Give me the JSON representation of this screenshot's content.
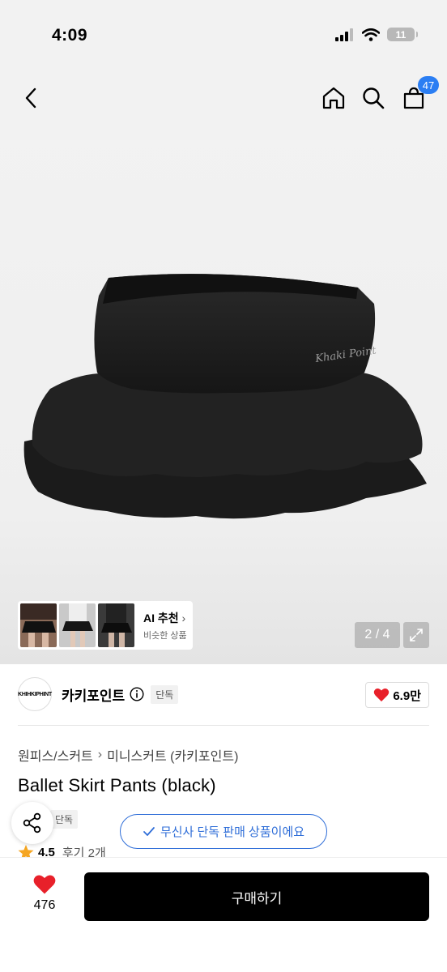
{
  "status_bar": {
    "time": "4:09",
    "battery": "11"
  },
  "nav": {
    "cart_count": "47"
  },
  "gallery": {
    "ai_title": "AI 추천",
    "ai_subtitle": "비슷한 상품",
    "page_indicator": "2 / 4"
  },
  "brand": {
    "logo_text": "KHIHKIPHINT",
    "name": "카키포인트",
    "tag": "단독",
    "likes": "6.9만"
  },
  "product": {
    "breadcrumb": [
      "원피스/스커트",
      "미니스커트 (카키포인트)"
    ],
    "title": "Ballet Skirt Pants (black)",
    "tag": "단독",
    "exclusive_notice": "무신사 단독 판매 상품이에요",
    "rating": "4.5",
    "review_label": "후기 2개"
  },
  "bottom": {
    "heart_count": "476",
    "buy_label": "구매하기"
  },
  "colors": {
    "accent_blue": "#2f6ed8",
    "badge_blue": "#2b7ef3",
    "heart_red": "#e8202a",
    "star_orange": "#f5a623"
  }
}
